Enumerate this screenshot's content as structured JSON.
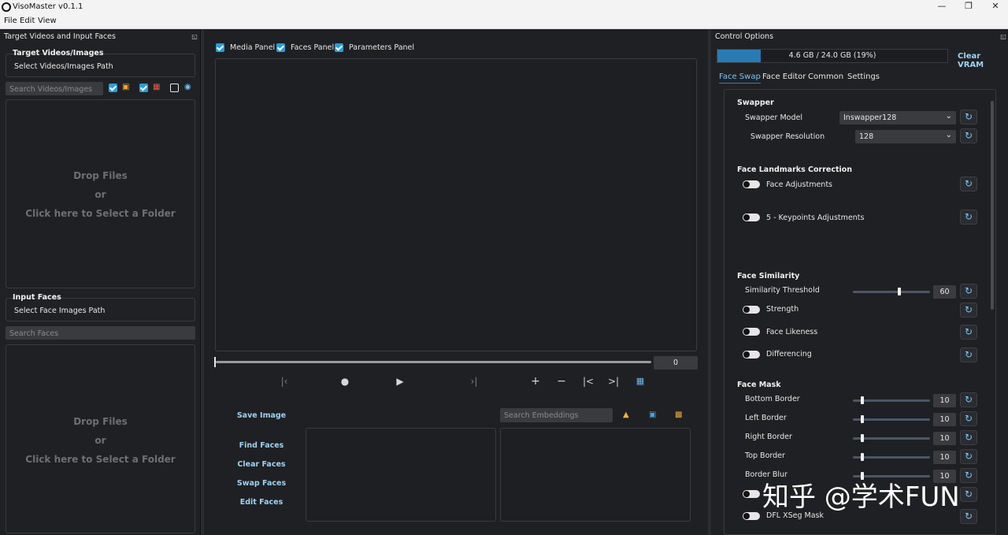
{
  "window": {
    "title": "VisoMaster v0.1.1"
  },
  "menu": [
    "File",
    "Edit",
    "View"
  ],
  "left_panel": {
    "dock_title": "Target Videos and Input Faces",
    "target_group_title": "Target Videos/Images",
    "target_path_label": "Select Videos/Images Path",
    "target_search_placeholder": "Search Videos/Images",
    "target_drop": {
      "line1": "Drop Files",
      "line2": "or",
      "line3": "Click here to Select a Folder"
    },
    "input_group_title": "Input Faces",
    "input_path_label": "Select Face Images Path",
    "input_search_placeholder": "Search Faces",
    "input_drop": {
      "line1": "Drop Files",
      "line2": "or",
      "line3": "Click here to Select a Folder"
    }
  },
  "center_panel": {
    "checks": [
      "Media Panel",
      "Faces Panel",
      "Parameters Panel"
    ],
    "frame_number": "0",
    "actions": {
      "save_image": "Save Image",
      "find_faces": "Find Faces",
      "clear_faces": "Clear Faces",
      "swap_faces": "Swap Faces",
      "edit_faces": "Edit Faces"
    },
    "embeddings_search_placeholder": "Search Embeddings"
  },
  "right_panel": {
    "dock_title": "Control Options",
    "vram": {
      "text": "4.6 GB / 24.0 GB (19%)",
      "used_fraction": 0.19
    },
    "clear_vram": "Clear VRAM",
    "tabs": [
      "Face Swap",
      "Face Editor",
      "Common",
      "Settings"
    ],
    "swapper": {
      "title": "Swapper",
      "model_label": "Swapper Model",
      "model_value": "Inswapper128",
      "resolution_label": "Swapper Resolution",
      "resolution_value": "128"
    },
    "landmarks": {
      "title": "Face Landmarks Correction",
      "face_adjustments": "Face Adjustments",
      "keypoints": "5 - Keypoints Adjustments"
    },
    "similarity": {
      "title": "Face Similarity",
      "threshold_label": "Similarity Threshold",
      "threshold_value": "60",
      "threshold_level": 0.6,
      "strength": "Strength",
      "likeness": "Face Likeness",
      "differencing": "Differencing"
    },
    "mask": {
      "title": "Face Mask",
      "bottom_label": "Bottom Border",
      "bottom_value": "10",
      "left_label": "Left Border",
      "left_value": "10",
      "right_label": "Right Border",
      "right_value": "10",
      "top_label": "Top Border",
      "top_value": "10",
      "blur_label": "Border Blur",
      "blur_value": "10",
      "xseg_label": "DFL XSeg Mask"
    }
  },
  "watermark": "知乎 @学术FUN",
  "colors": {
    "accent": "#2a9ed8",
    "link": "#9fd1f2",
    "background": "#1e1f22"
  }
}
